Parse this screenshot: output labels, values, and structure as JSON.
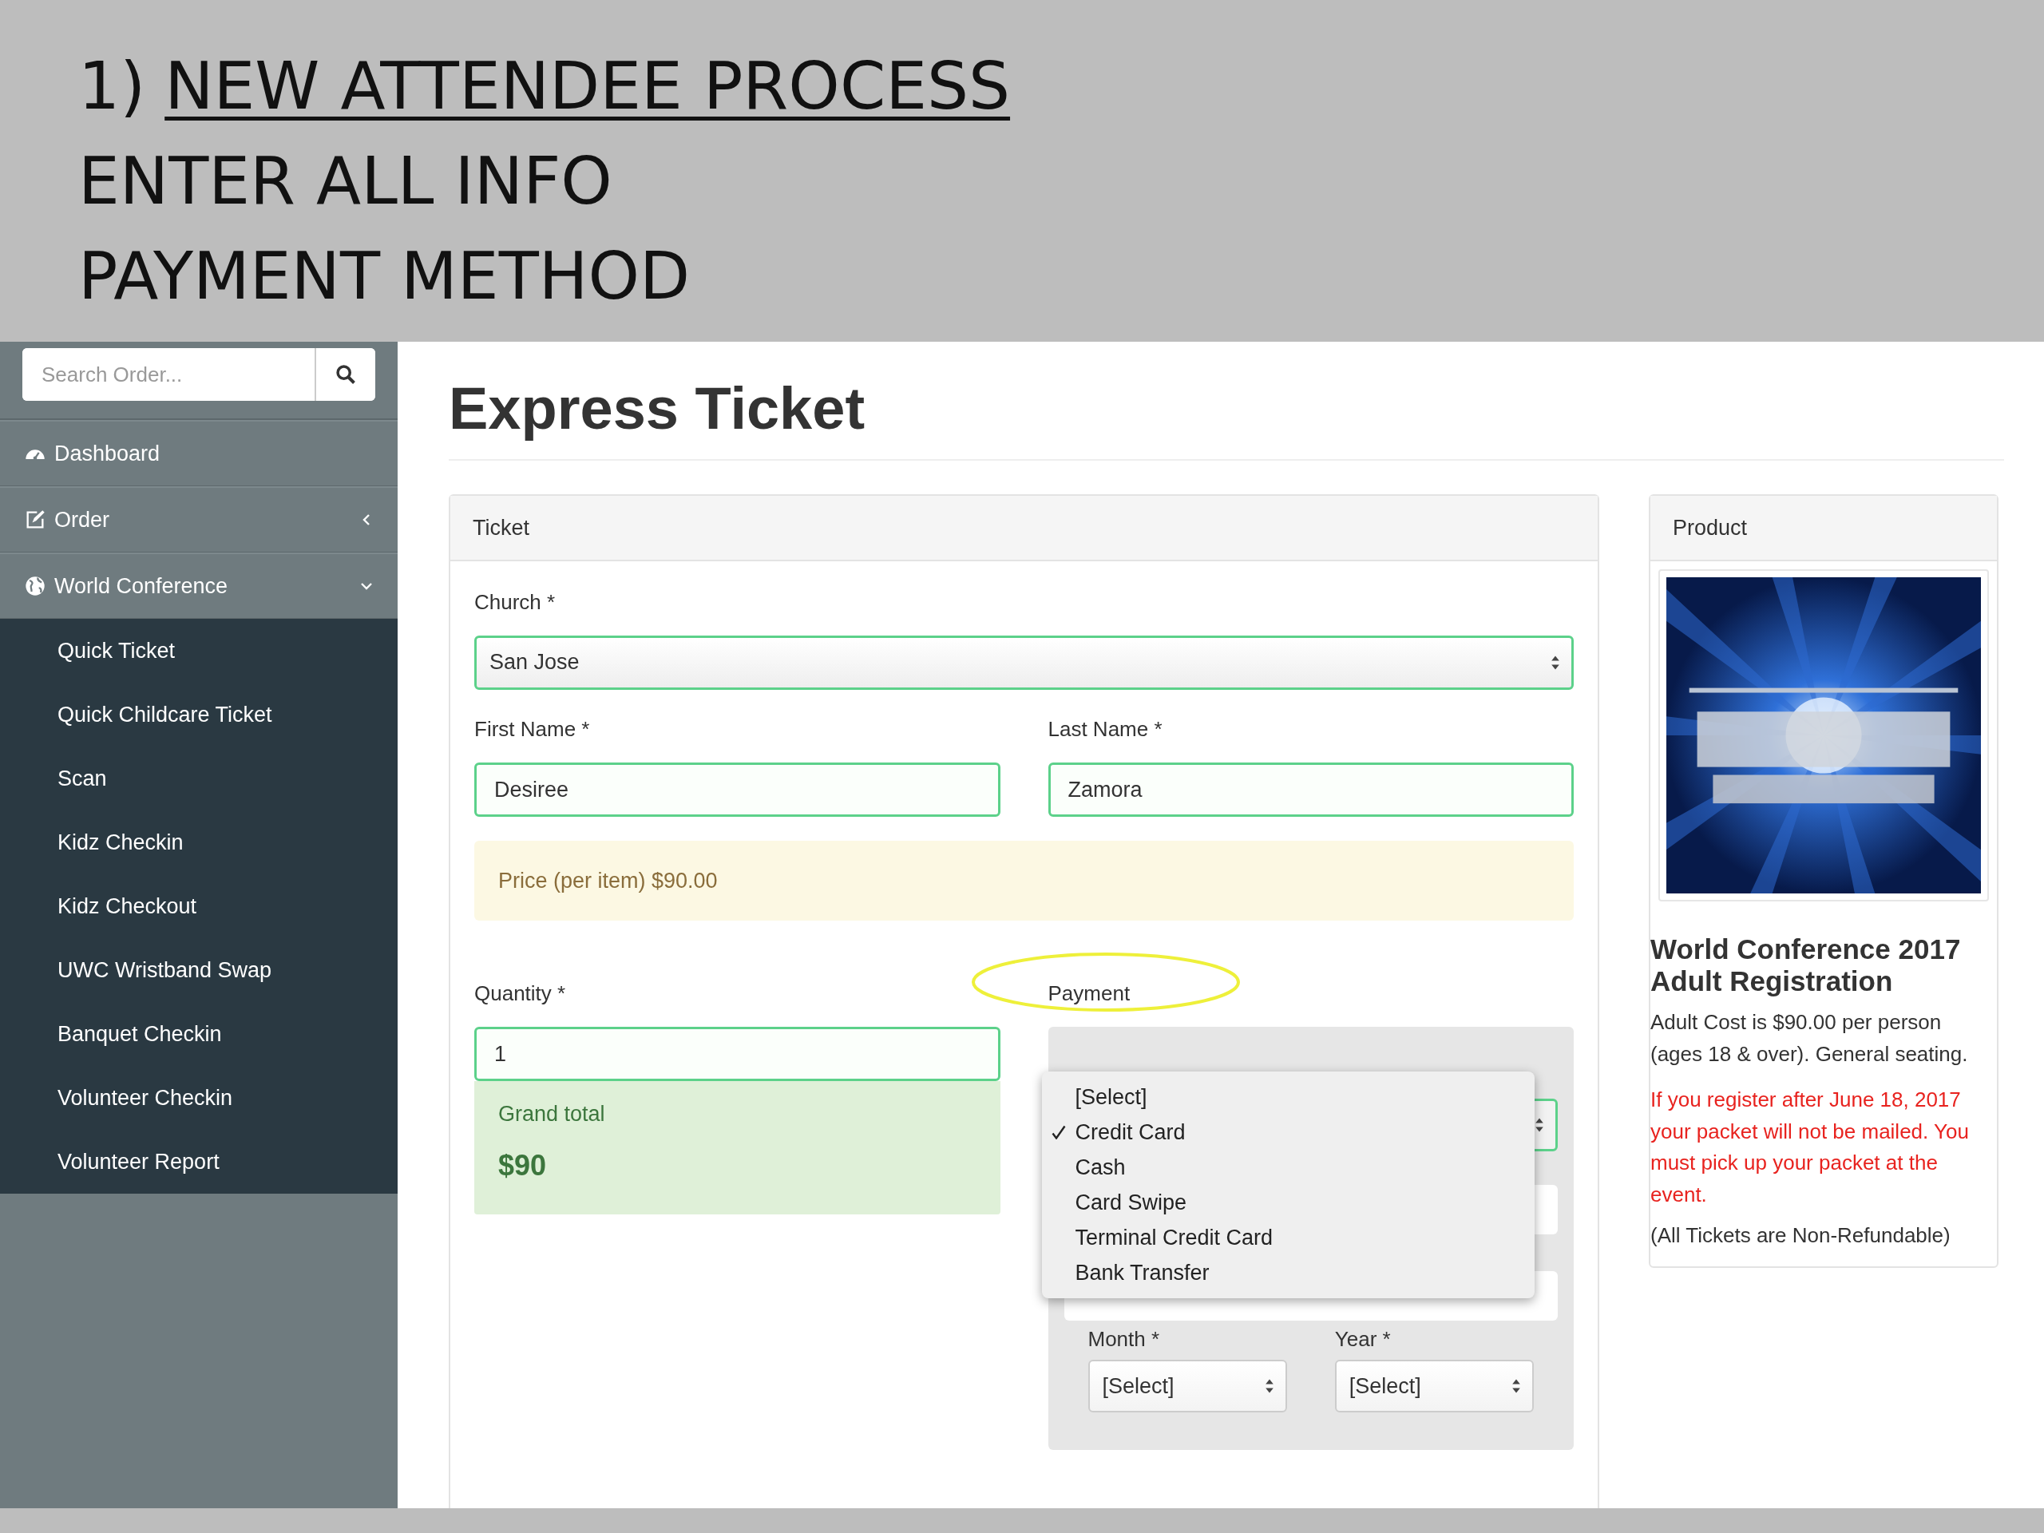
{
  "slide": {
    "number": "1)",
    "title": "NEW ATTENDEE PROCESS",
    "lines": [
      "ENTER ALL INFO",
      "PAYMENT METHOD"
    ]
  },
  "sidebar": {
    "search": {
      "placeholder": "Search Order..."
    },
    "items": [
      {
        "label": "Dashboard",
        "kind": "gauge"
      },
      {
        "label": "Order",
        "kind": "edit",
        "expanded": false
      },
      {
        "label": "World Conference",
        "kind": "globe",
        "expanded": true,
        "children": [
          {
            "label": "Quick Ticket"
          },
          {
            "label": "Quick Childcare Ticket"
          },
          {
            "label": "Scan"
          },
          {
            "label": "Kidz Checkin"
          },
          {
            "label": "Kidz Checkout"
          },
          {
            "label": "UWC Wristband Swap"
          },
          {
            "label": "Banquet Checkin"
          },
          {
            "label": "Volunteer Checkin"
          },
          {
            "label": "Volunteer Report"
          }
        ]
      }
    ]
  },
  "page_title": "Express Ticket",
  "ticket": {
    "heading": "Ticket",
    "church": {
      "label": "Church *",
      "value": "San Jose"
    },
    "first_name": {
      "label": "First Name *",
      "value": "Desiree"
    },
    "last_name": {
      "label": "Last Name *",
      "value": "Zamora"
    },
    "price": "Price (per item) $90.00",
    "quantity": {
      "label": "Quantity *",
      "value": "1"
    },
    "grand_total": {
      "label": "Grand total",
      "value": "$90"
    },
    "payment": {
      "label": "Payment",
      "highlighted": true,
      "options": [
        {
          "label": "[Select]",
          "selected": false
        },
        {
          "label": "Credit Card",
          "selected": true
        },
        {
          "label": "Cash",
          "selected": false
        },
        {
          "label": "Card Swipe",
          "selected": false
        },
        {
          "label": "Terminal Credit Card",
          "selected": false
        },
        {
          "label": "Bank Transfer",
          "selected": false
        }
      ],
      "month": {
        "label": "Month *",
        "value": "[Select]"
      },
      "year": {
        "label": "Year *",
        "value": "[Select]"
      }
    }
  },
  "product": {
    "heading": "Product",
    "title": "World Conference 2017 Adult Registration",
    "description": "Adult Cost is $90.00 per person (ages 18 & over). General seating.",
    "warning": "If you register after June 18, 2017 your packet will not be mailed. You must pick up your packet at the event.",
    "note": "(All Tickets are Non-Refundable)"
  }
}
